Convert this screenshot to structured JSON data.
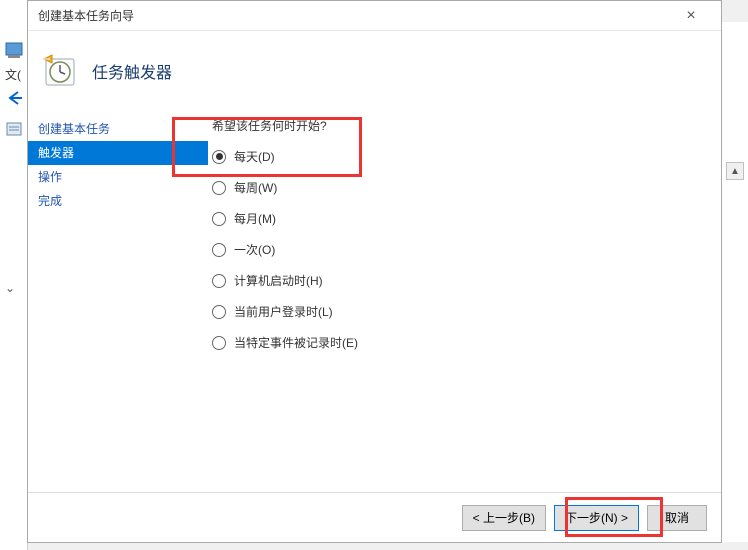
{
  "dialog": {
    "title": "创建基本任务向导",
    "header_title": "任务触发器",
    "close_icon": "×"
  },
  "nav": {
    "items": [
      {
        "label": "创建基本任务",
        "selected": false
      },
      {
        "label": "触发器",
        "selected": true
      },
      {
        "label": "操作",
        "selected": false
      },
      {
        "label": "完成",
        "selected": false
      }
    ]
  },
  "content": {
    "question": "希望该任务何时开始?",
    "options": [
      {
        "label": "每天(D)",
        "checked": true
      },
      {
        "label": "每周(W)",
        "checked": false
      },
      {
        "label": "每月(M)",
        "checked": false
      },
      {
        "label": "一次(O)",
        "checked": false
      },
      {
        "label": "计算机启动时(H)",
        "checked": false
      },
      {
        "label": "当前用户登录时(L)",
        "checked": false
      },
      {
        "label": "当特定事件被记录时(E)",
        "checked": false
      }
    ]
  },
  "footer": {
    "back": "< 上一步(B)",
    "next": "下一步(N) >",
    "cancel": "取消"
  },
  "background": {
    "file_label": "文("
  }
}
